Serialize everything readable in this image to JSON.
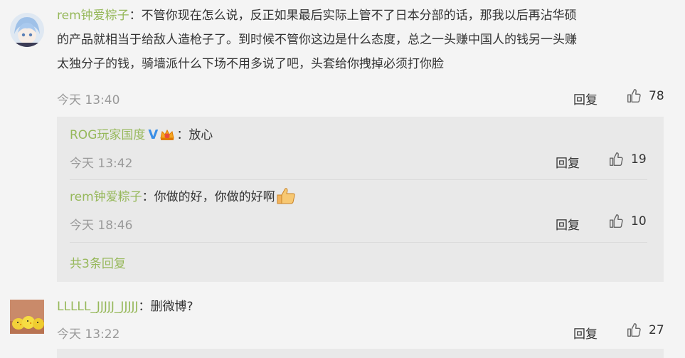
{
  "comments": [
    {
      "user": "rem钟爱粽子",
      "separator": "：",
      "lines": [
        "不管你现在怎么说，反正如果最后实际上管不了日本分部的话，那我以后再沾华硕",
        "的产品就相当于给敌人造枪子了。到时候不管你这边是什么态度，总之一头赚中国人的钱另一头赚",
        "太独分子的钱，骑墙派什么下场不用多说了吧，头套给你拽掉必须打你脸"
      ],
      "time": "今天 13:40",
      "reply_label": "回复",
      "likes": "78",
      "avatar_icon": "anime-avatar-icon"
    },
    {
      "user": "LLLLL_JJJJJ_JJJJJ",
      "separator": "：",
      "text": "删微博?",
      "time": "今天 13:22",
      "reply_label": "回复",
      "likes": "27",
      "avatar_icon": "yellow-chicks-avatar-icon"
    }
  ],
  "replies": [
    {
      "user": "ROG玩家国度",
      "verified": "V",
      "separator": "：",
      "text": "放心",
      "time": "今天 13:42",
      "reply_label": "回复",
      "likes": "19"
    },
    {
      "user": "rem钟爱粽子",
      "separator": "：",
      "text": "你做的好，你做的好啊",
      "time": "今天 18:46",
      "reply_label": "回复",
      "likes": "10"
    }
  ],
  "total_replies_label": "共3条回复",
  "colors": {
    "username": "#96b85a",
    "verified": "#3a8ee6",
    "background": "#f4f4f4",
    "subbox": "#e9e9e9"
  }
}
